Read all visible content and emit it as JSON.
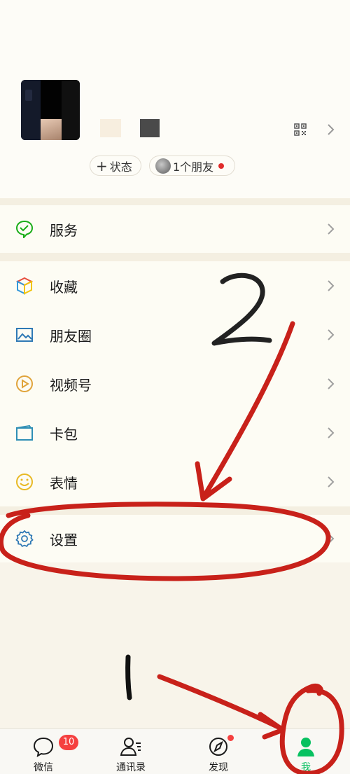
{
  "profile": {
    "status_pill": "状态",
    "friends_pill": "1个朋友"
  },
  "menu": {
    "services": "服务",
    "favorites": "收藏",
    "moments": "朋友圈",
    "channels": "视频号",
    "cards": "卡包",
    "stickers": "表情",
    "settings": "设置"
  },
  "tabs": {
    "chats": "微信",
    "chats_badge": "10",
    "contacts": "通讯录",
    "discover": "发现",
    "me": "我"
  },
  "annotations": {
    "step_one": "1",
    "step_two": "2"
  },
  "colors": {
    "accent_green": "#07c160",
    "badge_red": "#f5403f",
    "annotation_red": "#c8211a"
  }
}
